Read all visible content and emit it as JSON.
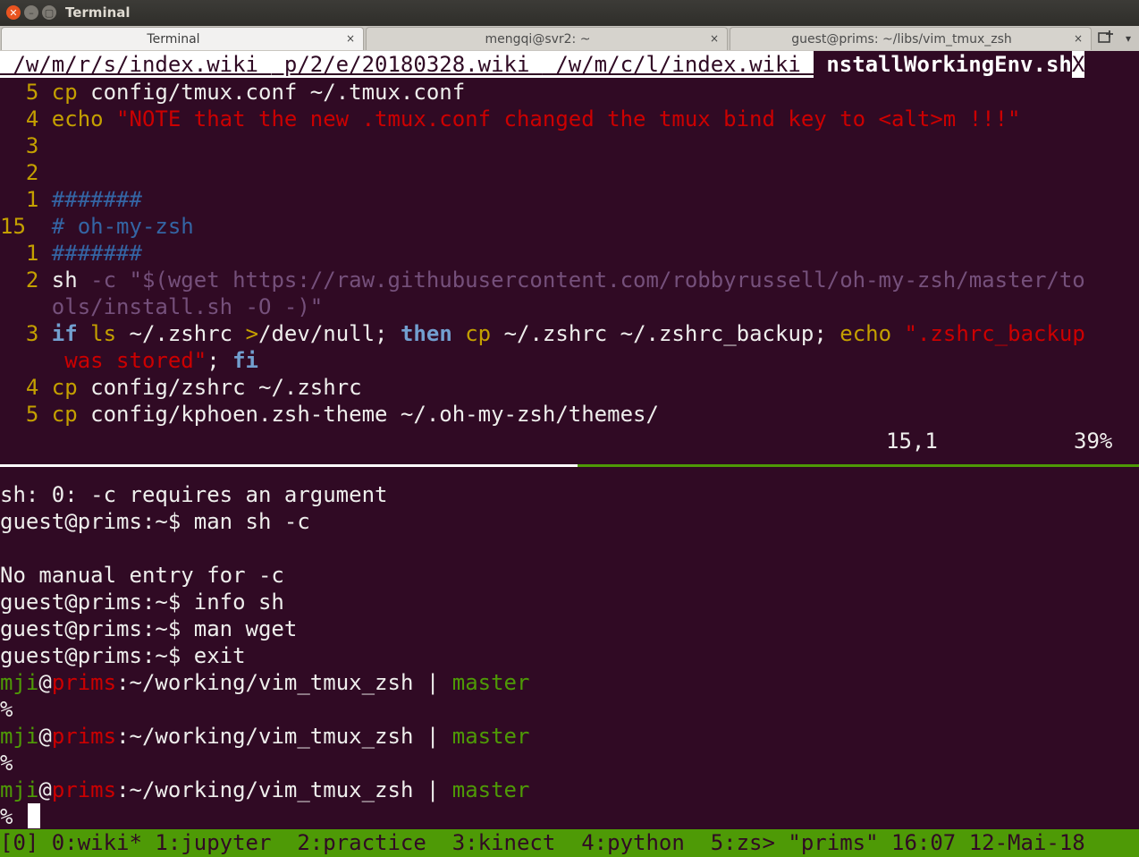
{
  "window": {
    "title": "Terminal",
    "colors": {
      "background": "#300a24",
      "accent": "#e95420",
      "status_bar": "#4e9a06"
    }
  },
  "tabs": [
    {
      "label": "Terminal",
      "close": "×",
      "active": true
    },
    {
      "label": "mengqi@svr2: ~",
      "close": "×",
      "active": false
    },
    {
      "label": "guest@prims: ~/libs/vim_tmux_zsh",
      "close": "×",
      "active": false
    }
  ],
  "tab_actions": {
    "new_tab_icon": "new-tab-icon",
    "menu_icon": "chevron-down-icon"
  },
  "vim": {
    "buffer_tabs": [
      " /w/m/r/s/index.wiki ",
      " p/2/e/20180328.wiki ",
      " /w/m/c/l/index.wiki "
    ],
    "selected_buffer": "nstallWorkingEnv.sh",
    "close_label": "X",
    "lines": {
      "l1": {
        "num": "  5 ",
        "cmd": "cp",
        "rest": " config/tmux.conf ~/.tmux.conf"
      },
      "l2": {
        "num": "  4 ",
        "cmd": "echo",
        "sp": " ",
        "str": "\"NOTE that the new .tmux.conf changed the tmux bind key to <alt>m !!!\""
      },
      "l3": {
        "num": "  3"
      },
      "l4": {
        "num": "  2"
      },
      "l5": {
        "num": "  1 ",
        "comment": "#######"
      },
      "l6": {
        "num": "15  ",
        "comment": "# oh-my-zsh"
      },
      "l7": {
        "num": "  1 ",
        "comment": "#######"
      },
      "l8": {
        "num": "  2 ",
        "cmd": "sh",
        "opt": " -c ",
        "str": "\"$(wget https://raw.githubusercontent.com/robbyrussell/oh-my-zsh/master/to"
      },
      "l9": {
        "indent": "    ",
        "str": "ols/install.sh -O -)\""
      },
      "l10": {
        "num": "  3 ",
        "if": "if",
        "ls": " ls",
        "a": " ~/.zshrc ",
        "redir": ">",
        "b": "/dev/null; ",
        "then": "then",
        "cp": " cp",
        "c": " ~/.zshrc ~/.zshrc_backup; ",
        "echo": "echo",
        "q": " \"",
        "str": ".zshrc_backup"
      },
      "l11": {
        "indent": "     ",
        "str": "was stored",
        "q": "\"",
        "semi": "; ",
        "fi": "fi"
      },
      "l12": {
        "num": "  4 ",
        "cmd": "cp",
        "rest": " config/zshrc ~/.zshrc"
      },
      "l13": {
        "num": "  5 ",
        "cmd": "cp",
        "rest": " config/kphoen.zsh-theme ~/.oh-my-zsh/themes/"
      }
    },
    "ruler": {
      "pos": "15,1",
      "percent": "39%"
    }
  },
  "shell": {
    "line1": "sh: 0: -c requires an argument",
    "line2": "guest@prims:~$ man sh -c",
    "line3": "",
    "line4": "No manual entry for -c",
    "line5": "guest@prims:~$ info sh",
    "line6": "guest@prims:~$ man wget",
    "line7": "guest@prims:~$ exit",
    "prompt": {
      "user": "mji",
      "at": "@",
      "host": "prims",
      "path": ":~/working/vim_tmux_zsh | ",
      "branch": "master",
      "symbol": "%"
    }
  },
  "tmux": {
    "status": "[0] 0:wiki* 1:jupyter  2:practice  3:kinect  4:python  5:zs> \"prims\" 16:07 12-Mai-18"
  }
}
